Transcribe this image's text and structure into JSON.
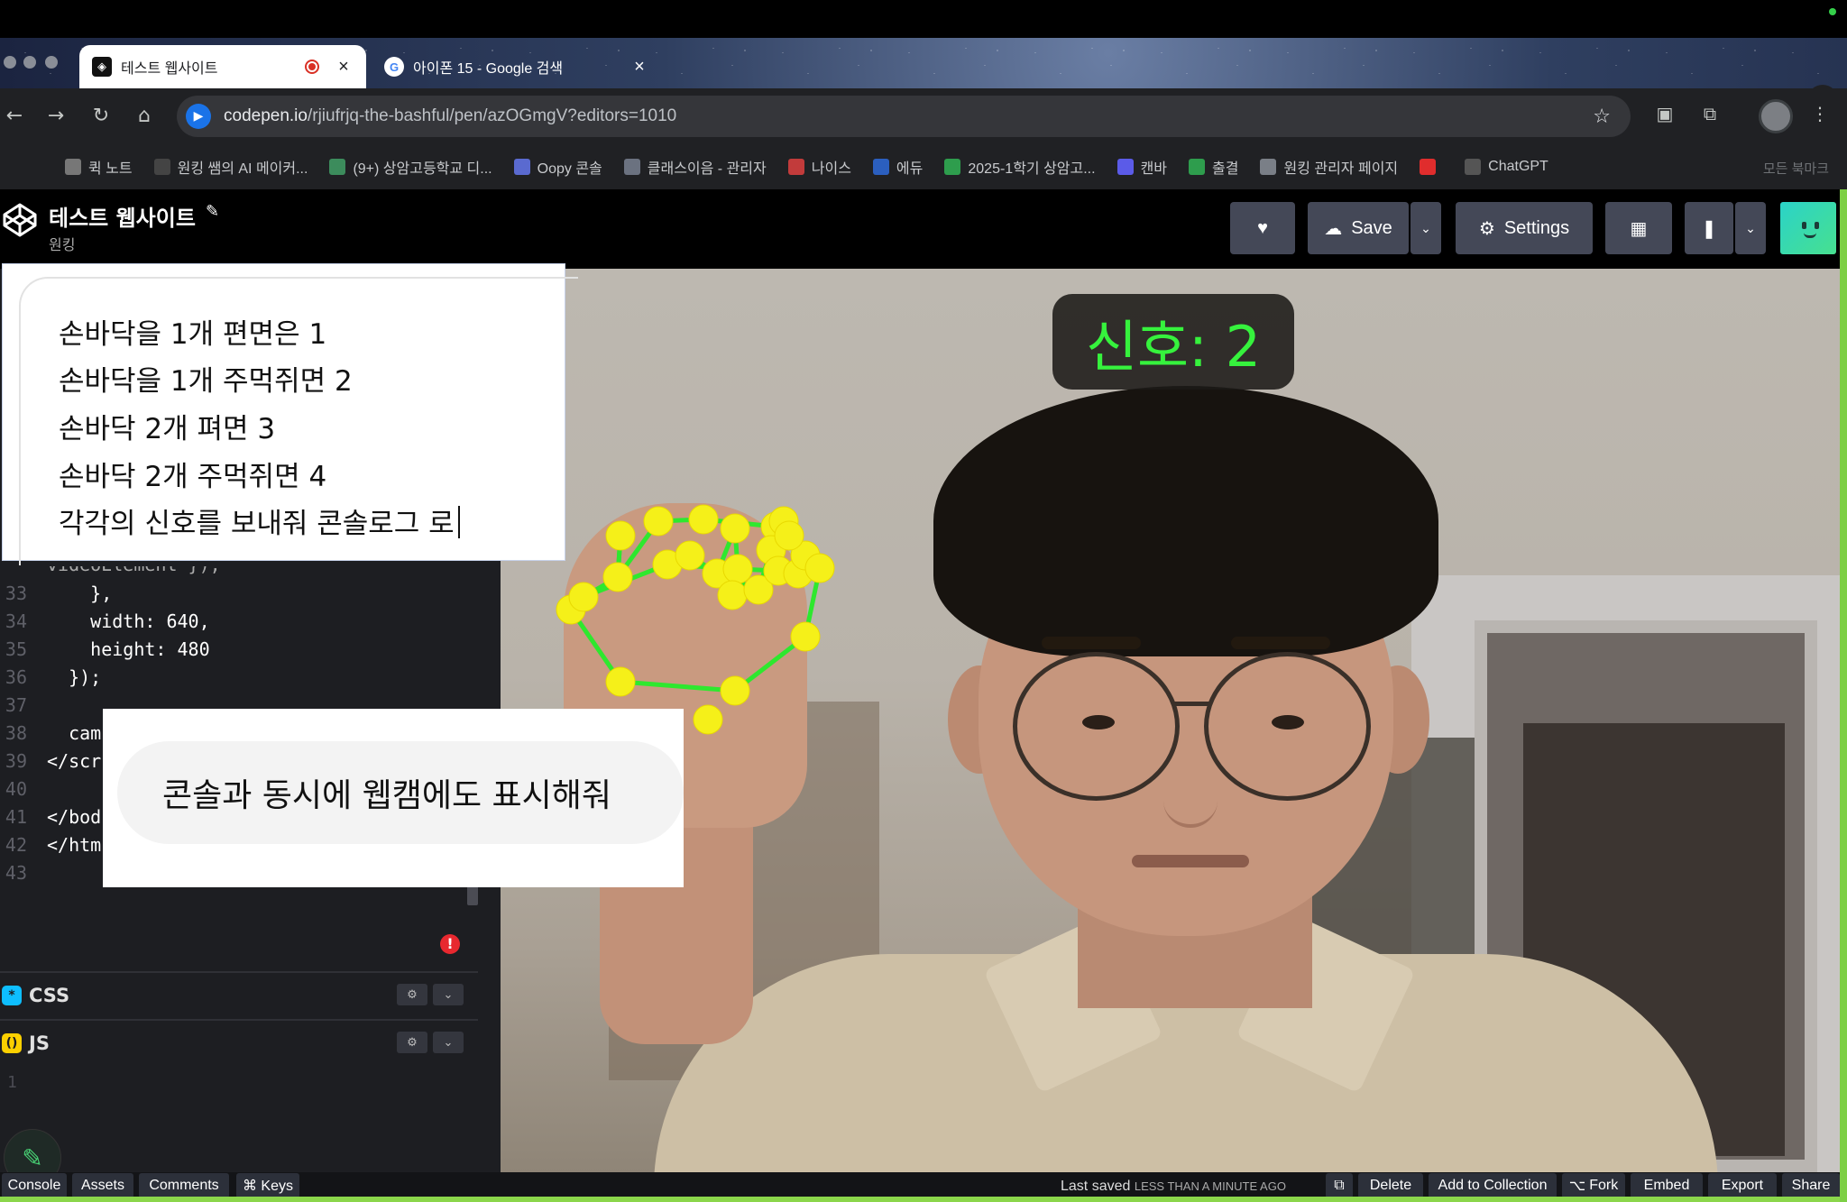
{
  "browser": {
    "tabs": [
      {
        "title": "테스트 웹사이트",
        "active": true
      },
      {
        "title": "아이폰 15 - Google 검색",
        "active": false
      }
    ],
    "new_tab": "+",
    "address": {
      "host": "codepen.io",
      "path": "/rjiufrjq-the-bashful/pen/azOGmgV?editors=1010"
    },
    "bookmarks": [
      {
        "label": "퀵 노트",
        "icon": "note-icon",
        "color": "#777777"
      },
      {
        "label": "원킹 쌤의 AI 메이커...",
        "icon": "notion-icon",
        "color": "#444444"
      },
      {
        "label": "(9+) 상암고등학교 디...",
        "icon": "chatgpt-icon",
        "color": "#3c8c5c"
      },
      {
        "label": "Oopy 콘솔",
        "icon": "cup-icon",
        "color": "#5a6ad0"
      },
      {
        "label": "클래스이음 - 관리자",
        "icon": "class-icon",
        "color": "#6b7280"
      },
      {
        "label": "나이스",
        "icon": "korea-icon",
        "color": "#c23b3b"
      },
      {
        "label": "에듀",
        "icon": "korea-icon",
        "color": "#2b5fbf"
      },
      {
        "label": "2025-1학기 상암고...",
        "icon": "sheets-plus-icon",
        "color": "#2e9d4d"
      },
      {
        "label": "캔바",
        "icon": "canva-icon",
        "color": "#5b5be8"
      },
      {
        "label": "출결",
        "icon": "sheets-plus-icon",
        "color": "#2e9d4d"
      },
      {
        "label": "원킹 관리자 페이지",
        "icon": "flag-icon",
        "color": "#7a7f87"
      },
      {
        "label": "",
        "icon": "youtube-icon",
        "color": "#e02d2d"
      },
      {
        "label": "ChatGPT",
        "icon": "openai-icon",
        "color": "#555555"
      }
    ],
    "all_bookmarks": "모든 북마크"
  },
  "codepen": {
    "title": "테스트 웹사이트",
    "author": "원킹",
    "save_label": "Save",
    "settings_label": "Settings",
    "code_lines": [
      {
        "n": "33",
        "text": "    },"
      },
      {
        "n": "34",
        "text": "    width: 640,"
      },
      {
        "n": "35",
        "text": "    height: 480"
      },
      {
        "n": "36",
        "text": "  });"
      },
      {
        "n": "37",
        "text": ""
      },
      {
        "n": "38",
        "text": "  cam"
      },
      {
        "n": "39",
        "text": "</scr"
      },
      {
        "n": "40",
        "text": ""
      },
      {
        "n": "41",
        "text": "</bod"
      },
      {
        "n": "42",
        "text": "</htm"
      },
      {
        "n": "43",
        "text": ""
      }
    ],
    "partial_line": "videoElement });",
    "css_label": "CSS",
    "js_label": "JS",
    "js_first_line": "1",
    "error_mark": "!"
  },
  "preview": {
    "signal_text": "신호: 2"
  },
  "prompt_card": {
    "lines": [
      "손바닥을 1개 편면은 1",
      "손바닥을 1개 주먹쥐면 2",
      "손바닥 2개 펴면 3",
      "손바닥 2개 주먹쥐면 4",
      "각각의 신호를 보내줘 콘솔로그 로"
    ]
  },
  "chat_bubble": {
    "text": "콘솔과 동시에 웹캠에도 표시해줘"
  },
  "footer": {
    "left": [
      "Console",
      "Assets",
      "Comments",
      "⌘ Keys"
    ],
    "last_saved": "Last saved",
    "last_saved_when": "LESS THAN A MINUTE AGO",
    "right": [
      "Delete",
      "Add to Collection",
      "Fork",
      "Embed",
      "Export",
      "Share"
    ]
  },
  "colors": {
    "landmark_dot": "#f5f019",
    "landmark_line": "#2ee82e",
    "signal_text": "#36f23d",
    "codepen_button": "#444857"
  }
}
